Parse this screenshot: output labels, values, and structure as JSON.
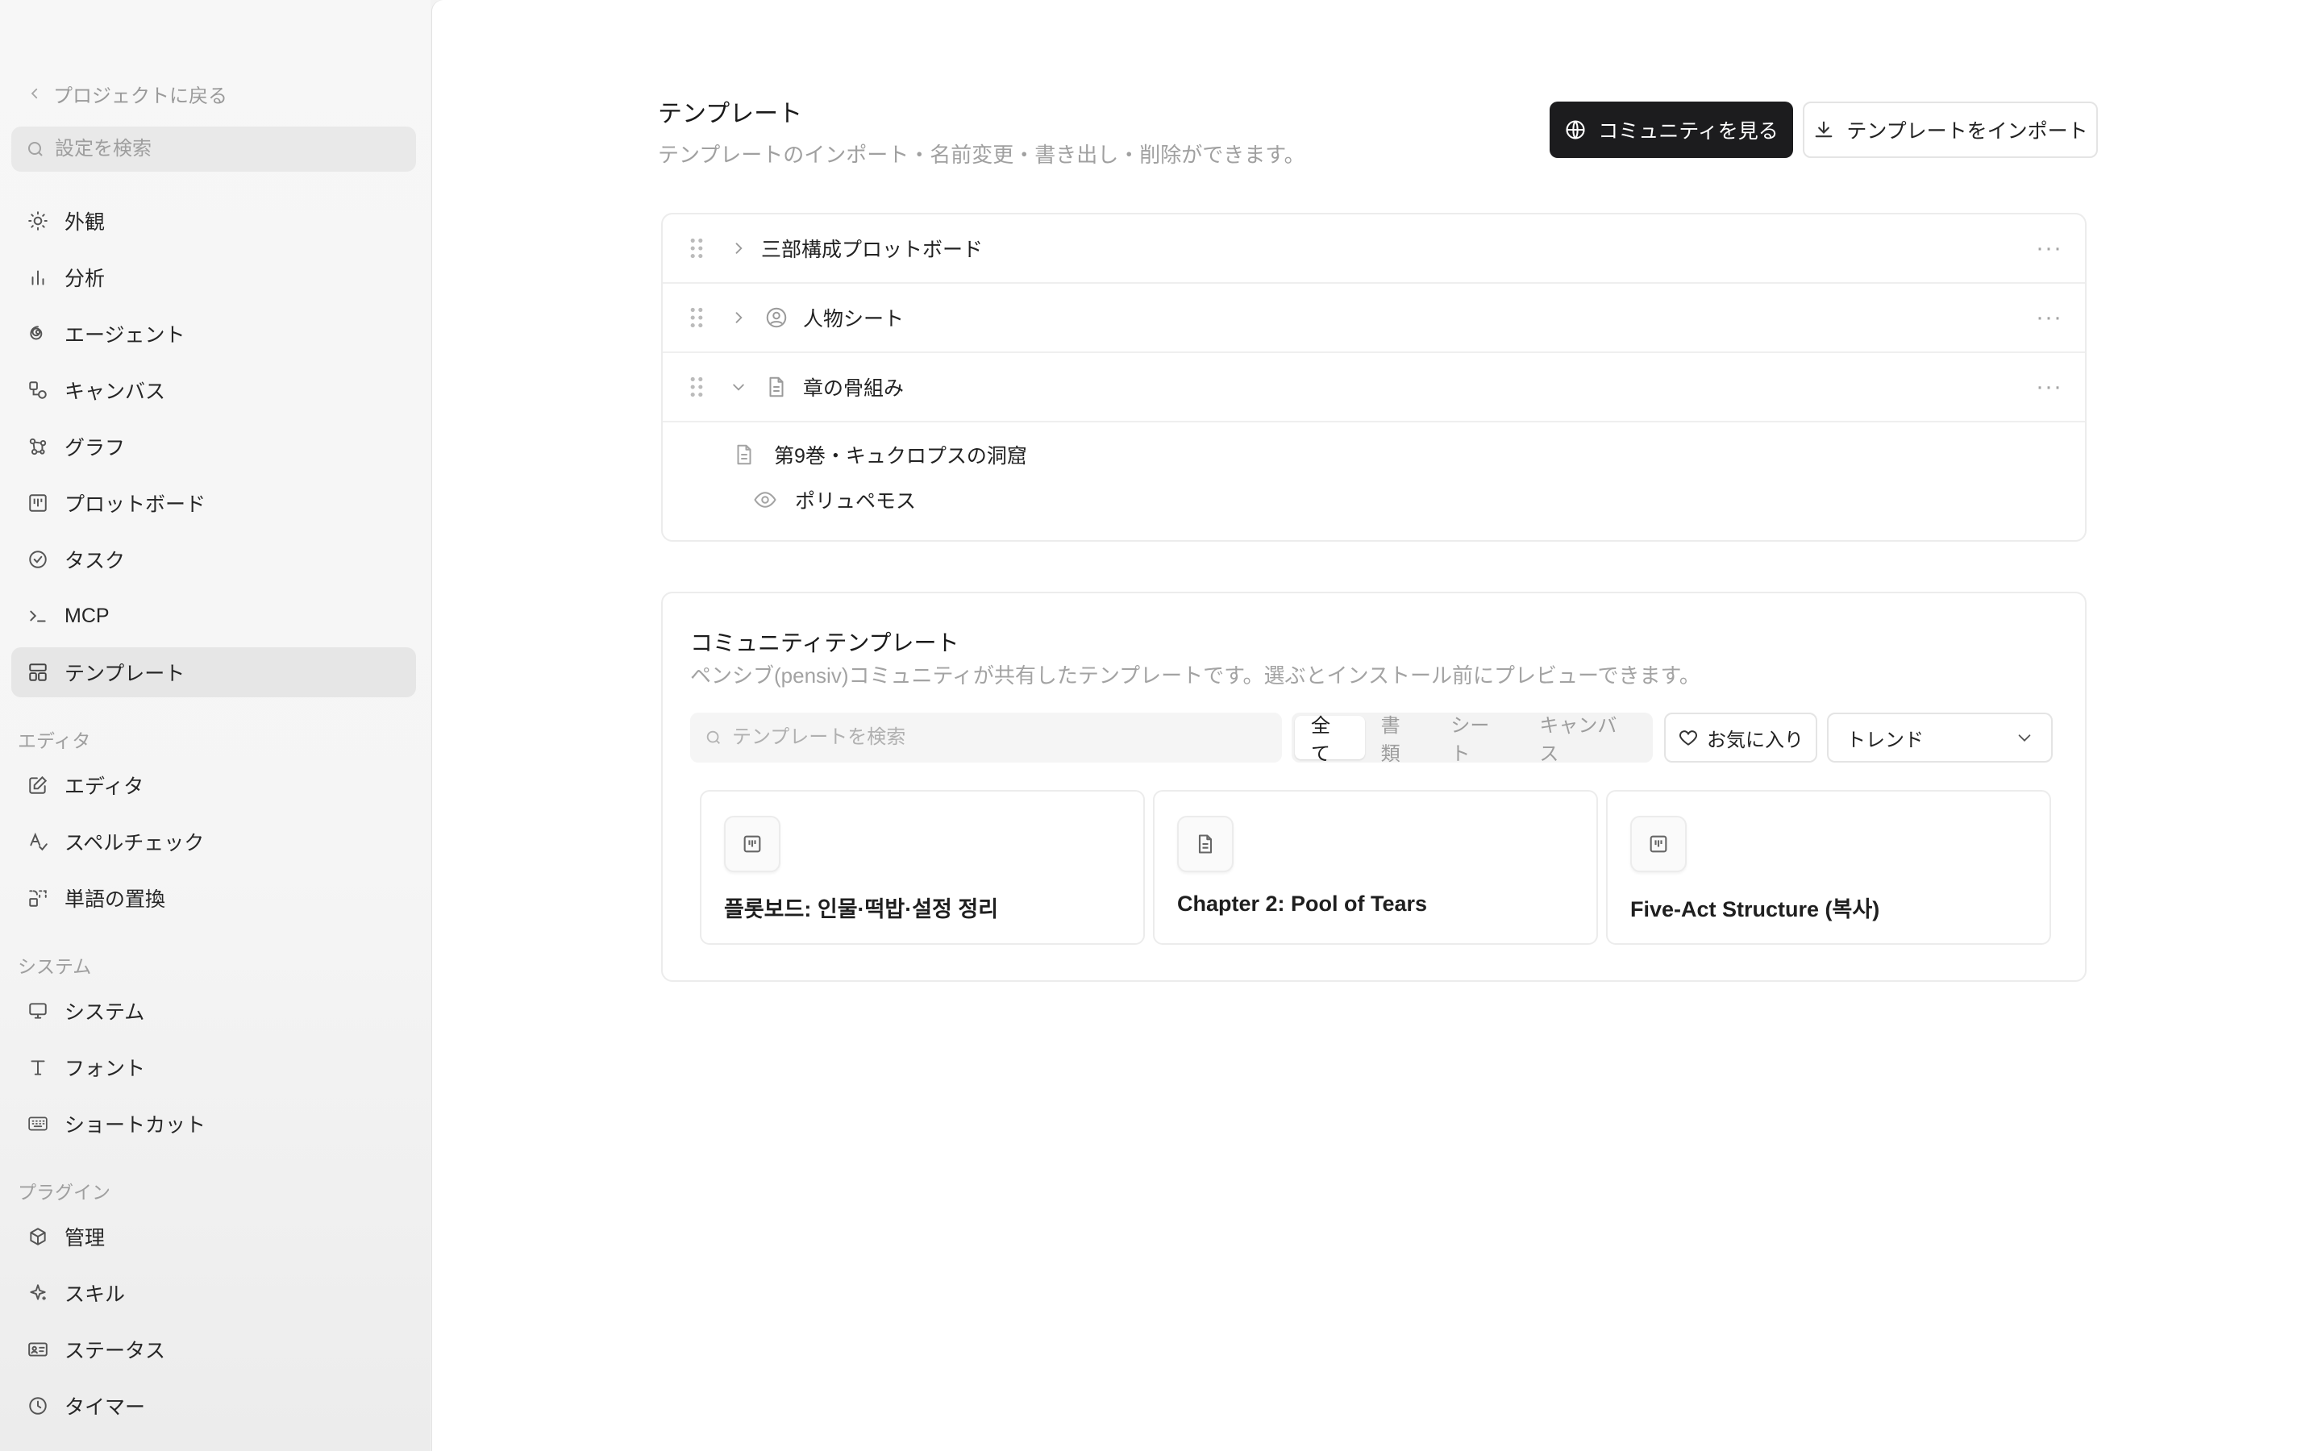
{
  "sidebar": {
    "back_label": "プロジェクトに戻る",
    "search_placeholder": "設定を検索",
    "items_general": [
      {
        "label": "外観",
        "icon": "sun-icon"
      },
      {
        "label": "分析",
        "icon": "bar-chart-icon"
      },
      {
        "label": "エージェント",
        "icon": "spiral-icon"
      },
      {
        "label": "キャンバス",
        "icon": "shapes-icon"
      },
      {
        "label": "グラフ",
        "icon": "graph-nodes-icon"
      },
      {
        "label": "プロットボード",
        "icon": "kanban-icon"
      },
      {
        "label": "タスク",
        "icon": "check-circle-icon"
      },
      {
        "label": "MCP",
        "icon": "terminal-icon"
      },
      {
        "label": "テンプレート",
        "icon": "layout-icon"
      }
    ],
    "section_editor": "エディタ",
    "items_editor": [
      {
        "label": "エディタ",
        "icon": "pencil-square-icon"
      },
      {
        "label": "スペルチェック",
        "icon": "spell-check-icon"
      },
      {
        "label": "単語の置換",
        "icon": "replace-icon"
      }
    ],
    "section_system": "システム",
    "items_system": [
      {
        "label": "システム",
        "icon": "monitor-icon"
      },
      {
        "label": "フォント",
        "icon": "type-icon"
      },
      {
        "label": "ショートカット",
        "icon": "keyboard-icon"
      }
    ],
    "section_plugins": "プラグイン",
    "items_plugins": [
      {
        "label": "管理",
        "icon": "package-icon"
      },
      {
        "label": "スキル",
        "icon": "sparkle-icon"
      },
      {
        "label": "ステータス",
        "icon": "id-card-icon"
      },
      {
        "label": "タイマー",
        "icon": "clock-icon"
      }
    ],
    "active_item": "テンプレート"
  },
  "header": {
    "title": "テンプレート",
    "subtitle": "テンプレートのインポート・名前変更・書き出し・削除ができます。",
    "community_button": "コミュニティを見る",
    "import_button": "テンプレートをインポート"
  },
  "templates": {
    "rows": [
      {
        "label": "三部構成プロットボード",
        "expanded": false
      },
      {
        "label": "人物シート",
        "expanded": false
      },
      {
        "label": "章の骨組み",
        "expanded": true
      }
    ],
    "children": [
      {
        "label": "第9巻・キュクロプスの洞窟"
      },
      {
        "label": "ポリュペモス"
      }
    ]
  },
  "community": {
    "title": "コミュニティテンプレート",
    "subtitle": "ペンシブ(pensiv)コミュニティが共有したテンプレートです。選ぶとインストール前にプレビューできます。",
    "search_placeholder": "テンプレートを検索",
    "filters": [
      "全て",
      "書類",
      "シート",
      "キャンバス"
    ],
    "active_filter": "全て",
    "favorites_label": "お気に入り",
    "sort_value": "トレンド",
    "cards": [
      {
        "title": "플롯보드: 인물·떡밥·설정 정리",
        "icon": "kanban-icon"
      },
      {
        "title": "Chapter 2: Pool of Tears",
        "icon": "document-icon"
      },
      {
        "title": "Five-Act Structure (복사)",
        "icon": "kanban-icon"
      }
    ]
  },
  "colors": {
    "accent_dark": "#1c1c1e",
    "active_nav_bg": "#e6e6e6"
  }
}
